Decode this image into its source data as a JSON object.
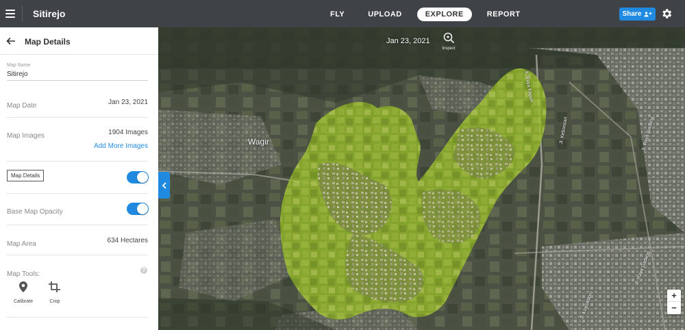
{
  "header": {
    "title": "Sitirejo",
    "nav": [
      {
        "label": "FLY"
      },
      {
        "label": "UPLOAD"
      },
      {
        "label": "EXPLORE"
      },
      {
        "label": "REPORT"
      }
    ],
    "share_label": "Share"
  },
  "sidebar": {
    "title": "Map Details",
    "map_name_label": "Map Name",
    "map_name_value": "Sitirejo",
    "map_date_label": "Map Date",
    "map_date_value": "Jan 23, 2021",
    "map_images_label": "Map Images",
    "map_images_value": "1904 Images",
    "add_more_images": "Add More Images",
    "map_details_toggle_label": "Map Details",
    "map_details_toggle_on": true,
    "base_map_opacity_label": "Base Map Opacity",
    "base_map_opacity_on": true,
    "map_area_label": "Map Area",
    "map_area_value": "634 Hectares",
    "map_tools_label": "Map Tools:",
    "tools": [
      {
        "label": "Calibrate",
        "icon": "location-pin-icon"
      },
      {
        "label": "Crop",
        "icon": "crop-icon"
      }
    ]
  },
  "map": {
    "date": "Jan 23, 2021",
    "inspect_label": "Inspect",
    "place_labels": [
      {
        "text": "Wagir"
      },
      {
        "text": "Jl. Raya Kepuh"
      },
      {
        "text": "Jl. Kebonsari"
      },
      {
        "text": "Jl. Raya Gadang"
      },
      {
        "text": "Jl. Raya Gadang"
      },
      {
        "text": "Jl. Lowokdoro"
      }
    ],
    "zoom_in": "+",
    "zoom_out": "−"
  },
  "colors": {
    "accent": "#1f8ae0",
    "topbar": "#3f4246",
    "overlay_green": "#8fb22a"
  }
}
